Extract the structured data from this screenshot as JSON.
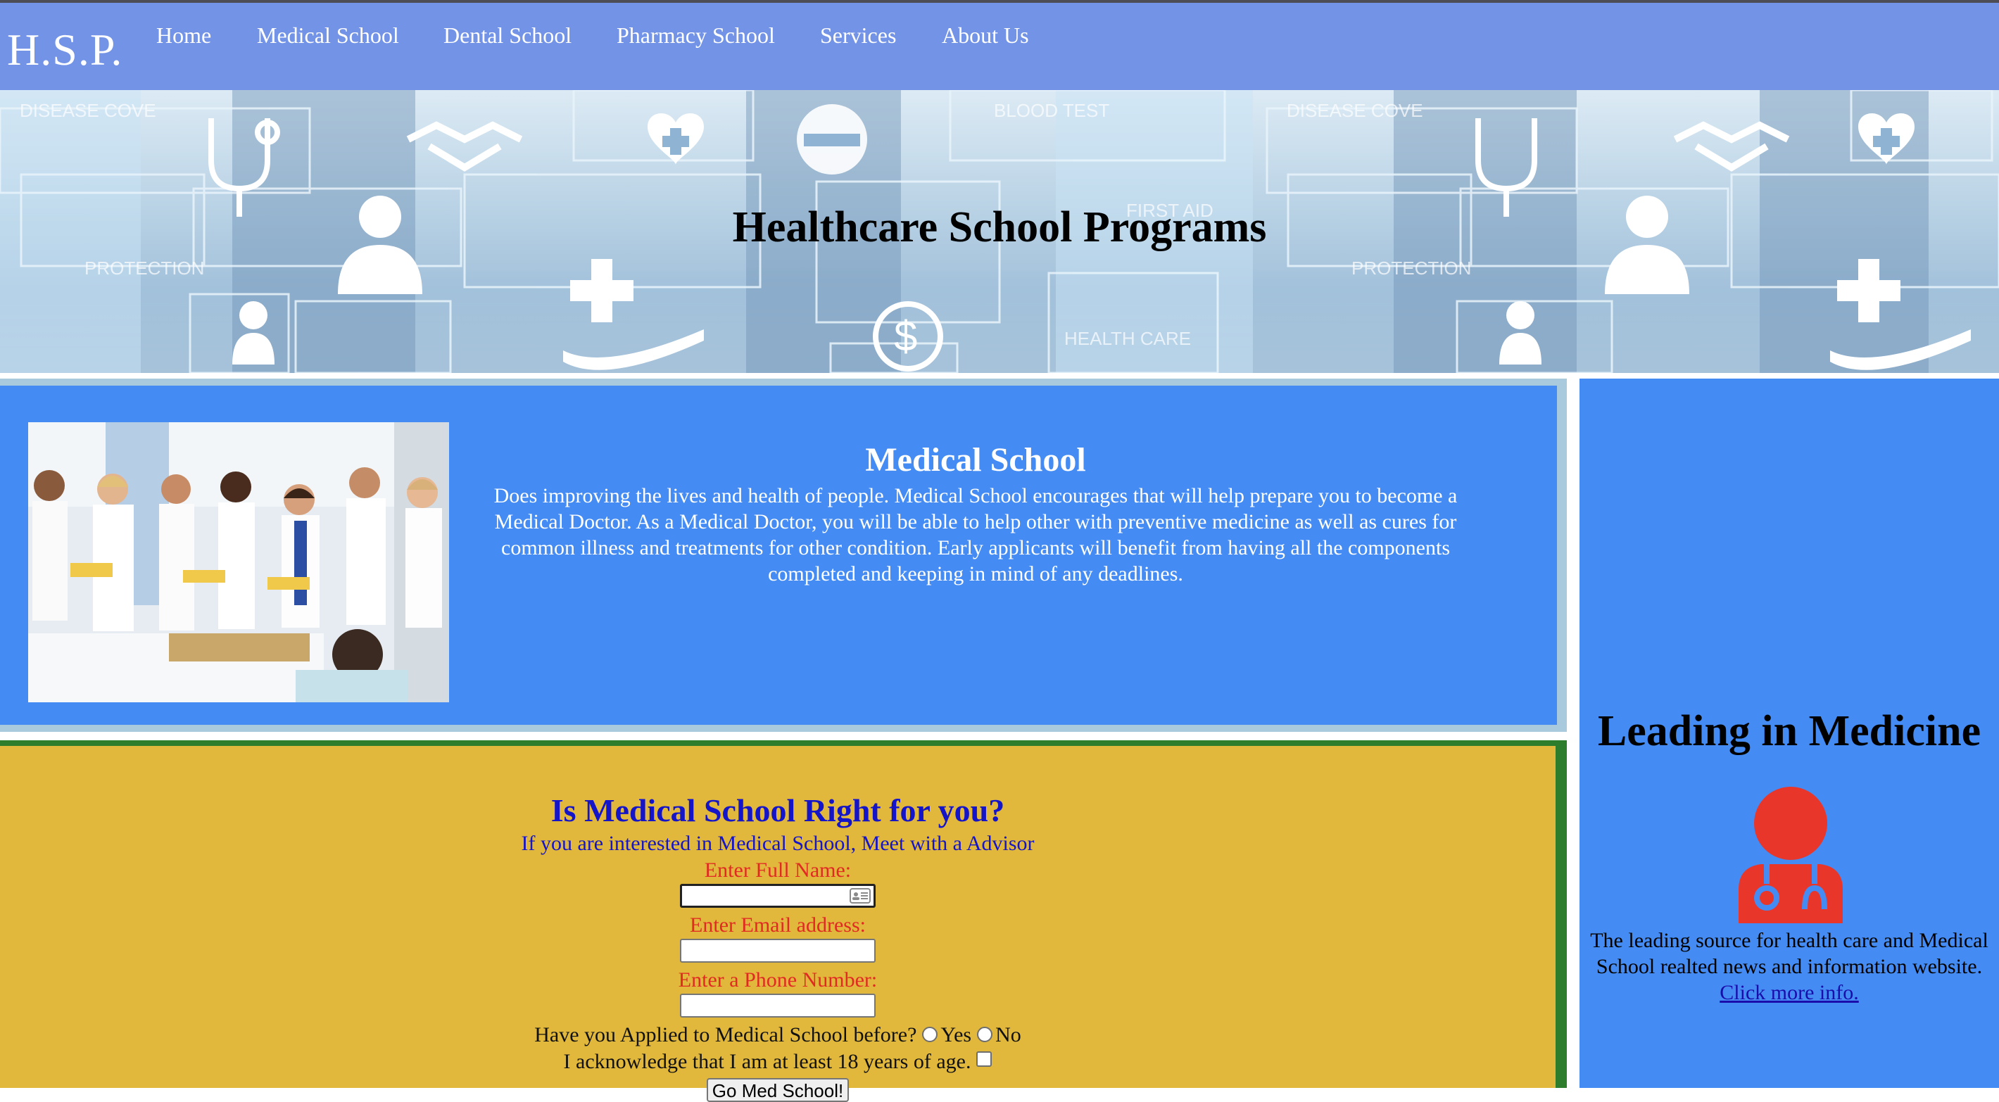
{
  "nav": {
    "brand": "H.S.P.",
    "links": [
      "Home",
      "Medical School",
      "Dental School",
      "Pharmacy School",
      "Services",
      "About Us"
    ]
  },
  "banner": {
    "title": "Healthcare School Programs",
    "overlay_words": [
      "DISEASE COVE",
      "BLOOD TEST",
      "PROTECTION",
      "FIRST AID",
      "HEALTH CARE",
      "DISEASE COVE",
      "PROTECTION"
    ]
  },
  "medical": {
    "heading": "Medical School",
    "text": "Does improving the lives and health of people. Medical School encourages that will help prepare you to become a Medical Doctor. As a Medical Doctor, you will be able to help other with preventive medicine as well as cures for common illness and treatments for other condition. Early applicants will benefit from having all the components completed and keeping in mind of any deadlines."
  },
  "form": {
    "heading": "Is Medical School Right for you?",
    "subheading": "If you are interested in Medical School, Meet with a Advisor",
    "name_label": "Enter Full Name:",
    "email_label": "Enter Email address:",
    "phone_label": "Enter a Phone Number:",
    "applied_question": "Have you Applied to Medical School before?",
    "yes_label": "Yes",
    "no_label": "No",
    "age_ack": "I acknowledge that I am at least 18 years of age.",
    "submit_label": "Go Med School!"
  },
  "aside": {
    "heading": "Leading in Medicine",
    "text": "The leading source for health care and Medical School realted news and information website.",
    "link": "Click more info."
  },
  "colors": {
    "nav_bg": "#7393e6",
    "section_blue": "#448cf3",
    "form_bg": "#e1b83c",
    "form_border": "#2d7d2c",
    "heading_blue": "#1414c8",
    "label_red": "#e02a22",
    "doctor_icon": "#e8362a"
  },
  "icons": [
    "contact-card-icon",
    "doctor-icon",
    "heart-plus-icon",
    "stethoscope-icon",
    "handshake-icon",
    "medical-cross-icon"
  ]
}
